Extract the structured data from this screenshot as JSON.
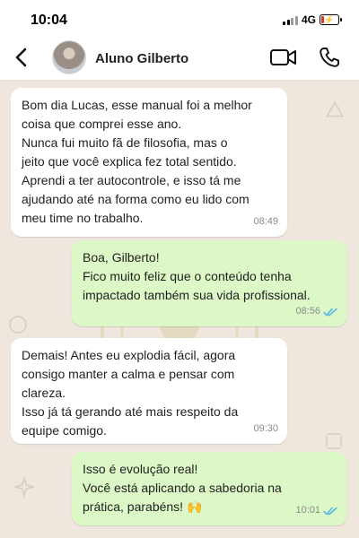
{
  "status_bar": {
    "time": "10:04",
    "network": "4G",
    "battery_level": 0.15,
    "battery_color": "#e0322e"
  },
  "header": {
    "contact_name": "Aluno Gilberto",
    "back_icon": "chevron-left-icon",
    "video_icon": "video-camera-icon",
    "call_icon": "phone-icon"
  },
  "messages": [
    {
      "direction": "in",
      "lines": [
        "Bom dia Lucas, esse manual foi a melhor",
        "coisa que comprei esse ano.",
        "Nunca fui muito fã de filosofia, mas o",
        "jeito que você explica fez total sentido.",
        "Aprendi a ter autocontrole, e isso tá me",
        "ajudando até na forma como eu lido com",
        "meu time no trabalho."
      ],
      "time": "08:49"
    },
    {
      "direction": "out",
      "lines": [
        "Boa, Gilberto!",
        "Fico muito feliz que o conteúdo tenha",
        "impactado também sua vida profissional."
      ],
      "time": "08:56",
      "status": "read"
    },
    {
      "direction": "in",
      "lines": [
        "Demais! Antes eu explodia fácil, agora",
        "consigo manter a calma e pensar com",
        "clareza.",
        "Isso já tá gerando até mais respeito da",
        "equipe comigo."
      ],
      "time": "09:30"
    },
    {
      "direction": "out",
      "lines": [
        "Isso é evolução real!",
        "Você está aplicando a sabedoria na",
        "prática, parabéns! 🙌"
      ],
      "time": "10:01",
      "status": "read"
    }
  ],
  "colors": {
    "chat_background": "#efe7de",
    "incoming_bubble": "#ffffff",
    "outgoing_bubble": "#dcf8c6",
    "read_ticks": "#4fb6ec"
  }
}
